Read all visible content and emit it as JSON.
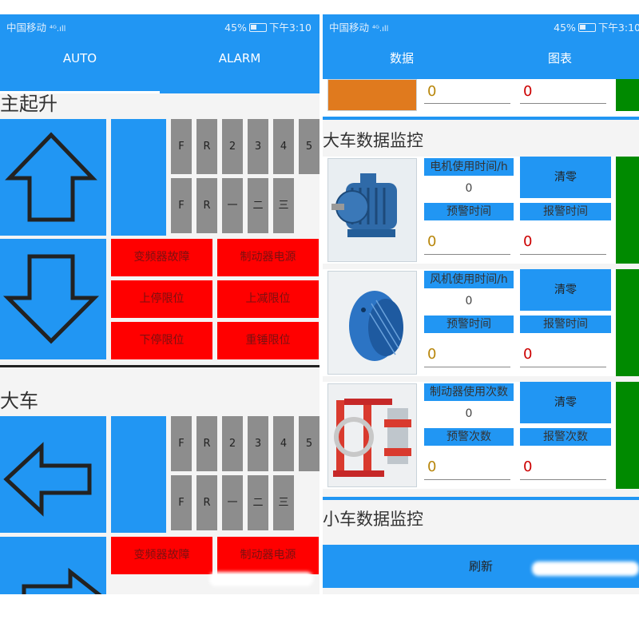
{
  "status": {
    "carrier": "中国移动",
    "signal": "⁴ᴳ.ıll",
    "battery": "45%",
    "time": "下午3:10"
  },
  "left": {
    "tabs": [
      "AUTO",
      "ALARM"
    ],
    "hoist": {
      "title": "主起升",
      "gear_row1": [
        "F",
        "R",
        "2",
        "3",
        "4",
        "5"
      ],
      "gear_row2": [
        "F",
        "R",
        "一",
        "二",
        "三"
      ],
      "faults": [
        "变频器故障",
        "制动器电源",
        "上停限位",
        "上减限位",
        "下停限位",
        "重锤限位"
      ]
    },
    "cart": {
      "title": "大车",
      "gear_row1": [
        "F",
        "R",
        "2",
        "3",
        "4",
        "5"
      ],
      "gear_row2": [
        "F",
        "R",
        "一",
        "二",
        "三"
      ],
      "faults": [
        "变频器故障",
        "制动器电源"
      ]
    }
  },
  "right": {
    "tabs": [
      "数据",
      "图表"
    ],
    "top_values": [
      "0",
      "0"
    ],
    "section_title": "大车数据监控",
    "monitors": [
      {
        "label": "电机使用时间/h",
        "value": "0",
        "reset": "清零",
        "warn_label": "预警时间",
        "alarm_label": "报警时间",
        "warn_value": "0",
        "alarm_value": "0",
        "image": "motor-image"
      },
      {
        "label": "风机使用时间/h",
        "value": "0",
        "reset": "清零",
        "warn_label": "预警时间",
        "alarm_label": "报警时间",
        "warn_value": "0",
        "alarm_value": "0",
        "image": "fan-image"
      },
      {
        "label": "制动器使用次数",
        "value": "0",
        "reset": "清零",
        "warn_label": "预警次数",
        "alarm_label": "报警次数",
        "warn_value": "0",
        "alarm_value": "0",
        "image": "brake-image"
      }
    ],
    "trolley_title": "小车数据监控",
    "refresh": "刷新"
  },
  "colors": {
    "accent": "#2196f3",
    "fault": "#ff0000",
    "ok": "#008a00",
    "gear": "#8d8d8d",
    "warn_value": "#b8860b",
    "alarm_value": "#cc0000"
  }
}
